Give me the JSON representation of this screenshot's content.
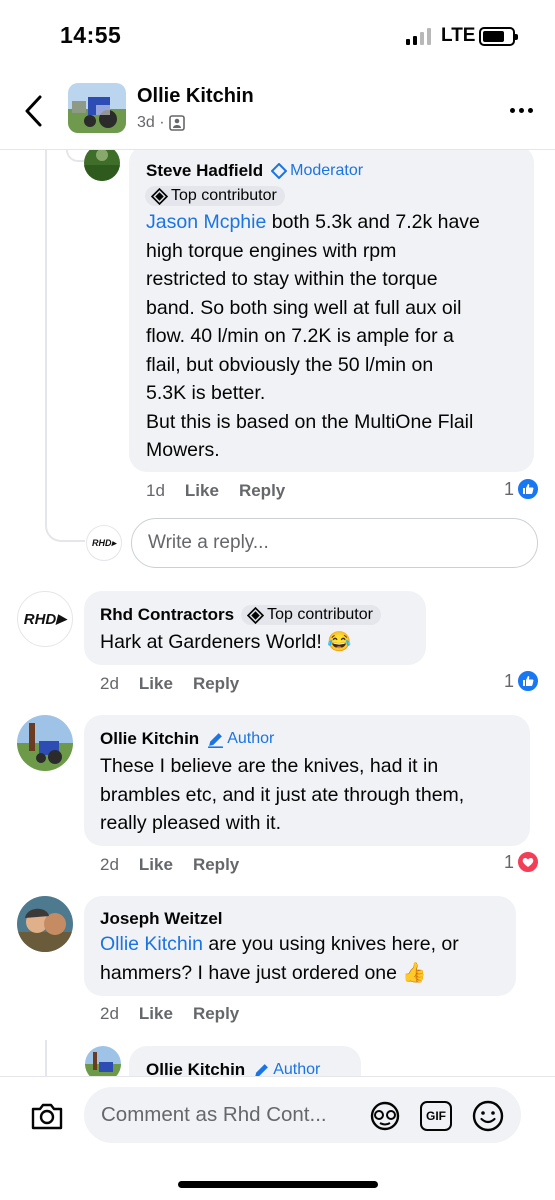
{
  "status_bar": {
    "time": "14:55",
    "network": "LTE"
  },
  "header": {
    "name": "Ollie Kitchin",
    "meta": "3d ·",
    "privacy_icon": "friends-icon",
    "more_icon": "more-icon"
  },
  "comments": [
    {
      "name": "Steve Hadfield",
      "badge": "Moderator",
      "badge2": "Top contributor",
      "mention": "Jason Mcphie",
      "text_lines": [
        " both 5.3k and 7.2k have",
        "high torque engines with rpm",
        "restricted to stay within the torque",
        "band. So both sing well at full aux oil",
        "flow. 40 l/min on 7.2K is ample for a",
        "flail, but obviously the 50 l/min on",
        "5.3K is better.",
        "But this is based on the MultiOne Flail",
        "Mowers."
      ],
      "time": "1d",
      "like": "Like",
      "reply": "Reply",
      "reactions": "1",
      "reaction_type": "like"
    },
    {
      "name": "Rhd Contractors",
      "badge": "Top contributor",
      "text": "Hark at Gardeners World! 😂",
      "time": "2d",
      "like": "Like",
      "reply": "Reply",
      "reactions": "1",
      "reaction_type": "like",
      "logo_text": "RHD"
    },
    {
      "name": "Ollie Kitchin",
      "badge": "Author",
      "text_lines": [
        "These I believe are the knives, had it in",
        "brambles etc, and it just ate through them,",
        "really pleased with it."
      ],
      "time": "2d",
      "like": "Like",
      "reply": "Reply",
      "reactions": "1",
      "reaction_type": "love"
    },
    {
      "name": "Joseph Weitzel",
      "mention": "Ollie Kitchin",
      "text_line1": " are you using knives here, or",
      "text_line2": "hammers? I have just ordered one 👍",
      "time": "2d",
      "like": "Like",
      "reply": "Reply"
    },
    {
      "name": "Ollie Kitchin",
      "badge": "Author"
    }
  ],
  "reply_box": {
    "placeholder": "Write a reply...",
    "logo_text": "RHD"
  },
  "composer": {
    "placeholder": "Comment as Rhd Cont...",
    "icons": [
      "camera-icon",
      "avatar-sticker-icon",
      "gif-icon",
      "emoji-icon"
    ],
    "gif_label": "GIF"
  },
  "colors": {
    "accent": "#1b74e4",
    "bubble": "#f0f2f5",
    "love": "#f33e58",
    "like": "#1877f2"
  }
}
